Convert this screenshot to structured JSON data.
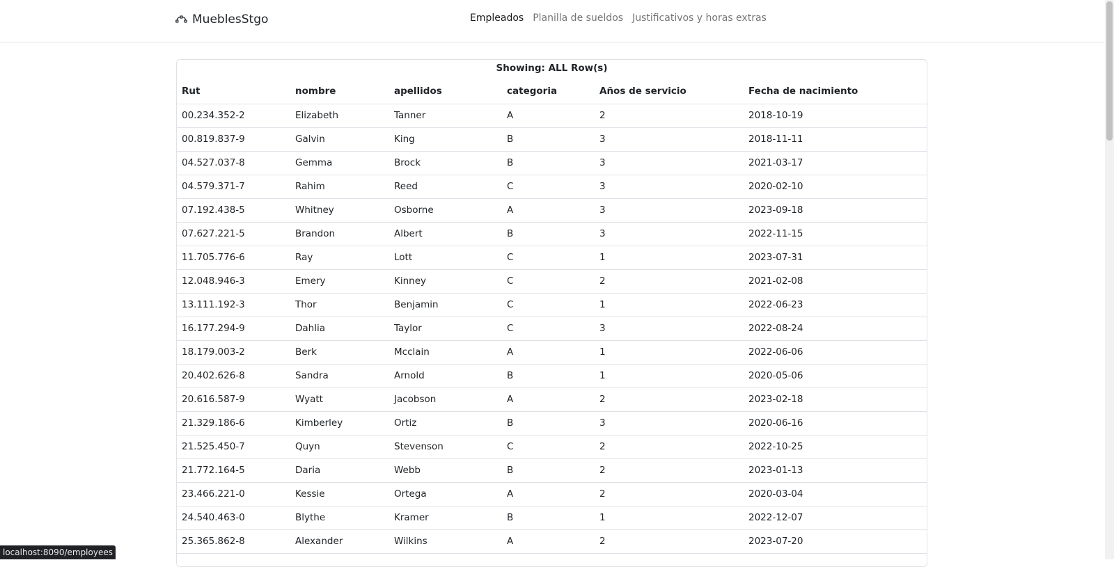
{
  "navbar": {
    "brand": "MueblesStgo",
    "brand_icon": "bezier-icon",
    "links": [
      "Empleados",
      "Planilla de sueldos",
      "Justificativos y horas extras"
    ],
    "active_index": 0
  },
  "table": {
    "caption_prefix": "Showing: ",
    "caption_count": "ALL",
    "caption_suffix": " Row(s)",
    "columns": [
      "Rut",
      "nombre",
      "apellidos",
      "categoria",
      "Años de servicio",
      "Fecha de nacimiento"
    ],
    "rows": [
      [
        "00.234.352-2",
        "Elizabeth",
        "Tanner",
        "A",
        "2",
        "2018-10-19"
      ],
      [
        "00.819.837-9",
        "Galvin",
        "King",
        "B",
        "3",
        "2018-11-11"
      ],
      [
        "04.527.037-8",
        "Gemma",
        "Brock",
        "B",
        "3",
        "2021-03-17"
      ],
      [
        "04.579.371-7",
        "Rahim",
        "Reed",
        "C",
        "3",
        "2020-02-10"
      ],
      [
        "07.192.438-5",
        "Whitney",
        "Osborne",
        "A",
        "3",
        "2023-09-18"
      ],
      [
        "07.627.221-5",
        "Brandon",
        "Albert",
        "B",
        "3",
        "2022-11-15"
      ],
      [
        "11.705.776-6",
        "Ray",
        "Lott",
        "C",
        "1",
        "2023-07-31"
      ],
      [
        "12.048.946-3",
        "Emery",
        "Kinney",
        "C",
        "2",
        "2021-02-08"
      ],
      [
        "13.111.192-3",
        "Thor",
        "Benjamin",
        "C",
        "1",
        "2022-06-23"
      ],
      [
        "16.177.294-9",
        "Dahlia",
        "Taylor",
        "C",
        "3",
        "2022-08-24"
      ],
      [
        "18.179.003-2",
        "Berk",
        "Mcclain",
        "A",
        "1",
        "2022-06-06"
      ],
      [
        "20.402.626-8",
        "Sandra",
        "Arnold",
        "B",
        "1",
        "2020-05-06"
      ],
      [
        "20.616.587-9",
        "Wyatt",
        "Jacobson",
        "A",
        "2",
        "2023-02-18"
      ],
      [
        "21.329.186-6",
        "Kimberley",
        "Ortiz",
        "B",
        "3",
        "2020-06-16"
      ],
      [
        "21.525.450-7",
        "Quyn",
        "Stevenson",
        "C",
        "2",
        "2022-10-25"
      ],
      [
        "21.772.164-5",
        "Daria",
        "Webb",
        "B",
        "2",
        "2023-01-13"
      ],
      [
        "23.466.221-0",
        "Kessie",
        "Ortega",
        "A",
        "2",
        "2020-03-04"
      ],
      [
        "24.540.463-0",
        "Blythe",
        "Kramer",
        "B",
        "1",
        "2022-12-07"
      ],
      [
        "25.365.862-8",
        "Alexander",
        "Wilkins",
        "A",
        "2",
        "2023-07-20"
      ]
    ]
  },
  "status_bar": {
    "url": "localhost:8090/employees"
  }
}
